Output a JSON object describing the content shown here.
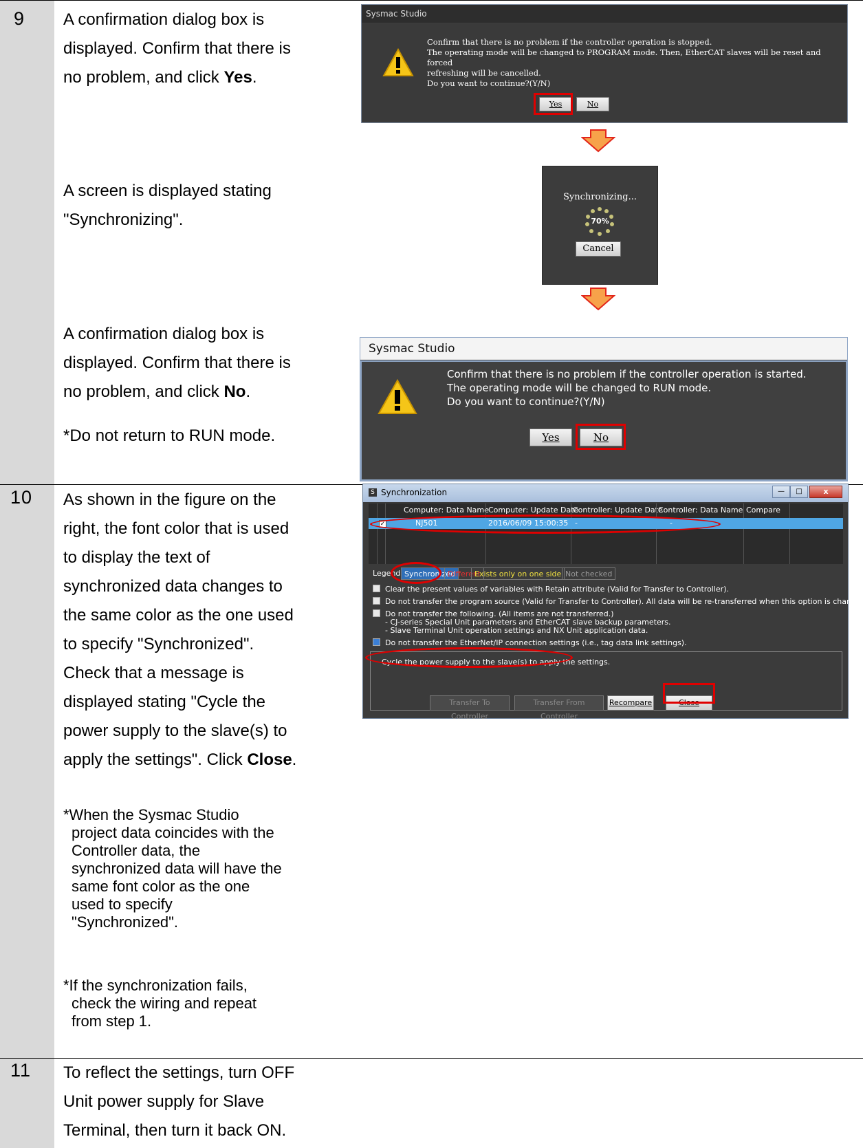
{
  "steps": [
    {
      "number": "9"
    },
    {
      "number": "10"
    },
    {
      "number": "11"
    }
  ],
  "step9": {
    "text1_lines": [
      "A confirmation dialog box is",
      "displayed. Confirm that there is",
      "no problem, and click "
    ],
    "text1_bold": "Yes",
    "text1_end": ".",
    "text2_lines": [
      "A screen is displayed stating",
      "\"Synchronizing\"."
    ],
    "text3_lines": [
      "A confirmation dialog box is",
      "displayed. Confirm that there is",
      "no problem, and click "
    ],
    "text3_bold": "No",
    "text3_end": ".",
    "text3_note": "*Do not return to RUN mode."
  },
  "dialog1": {
    "title": "Sysmac Studio",
    "lines": [
      "Confirm that there is no problem if the controller operation is stopped.",
      "The operating mode will be changed to PROGRAM mode. Then, EtherCAT slaves will be reset and forced",
      "refreshing will be cancelled.",
      "Do you want to continue?(Y/N)"
    ],
    "yes": "Yes",
    "no": "No"
  },
  "progress": {
    "title": "Synchronizing...",
    "percent": "70%",
    "cancel": "Cancel"
  },
  "dialog2": {
    "title": "Sysmac Studio",
    "lines": [
      "Confirm that there is no problem if the controller operation is started.",
      "The operating mode will be changed to RUN mode.",
      "Do you want to continue?(Y/N)"
    ],
    "yes": "Yes",
    "no": "No"
  },
  "step10": {
    "lines": [
      "As shown in the figure on the",
      "right, the font color that is used",
      "to display the text of",
      "synchronized data changes to",
      "the same color as the one used",
      "to specify \"Synchronized\".",
      "Check that a message is",
      "displayed stating \"Cycle the",
      "power supply to the slave(s) to",
      "apply the settings\". Click "
    ],
    "bold": "Close",
    "end": ".",
    "note1": [
      "*When the Sysmac Studio",
      "project data coincides with the",
      "Controller data, the",
      "synchronized data will have the",
      "same font color as the one",
      "used to specify",
      "\"Synchronized\"."
    ],
    "note2": [
      "*If the synchronization fails,",
      "check the wiring and repeat",
      "from step 1."
    ]
  },
  "sync": {
    "title": "Synchronization",
    "columns": [
      "Computer: Data Name",
      "Computer: Update Date",
      "Controller: Update Date",
      "Controller: Data Name",
      "Compare"
    ],
    "row": {
      "name": "NJ501",
      "computer_date": "2016/06/09 15:00:35",
      "controller_date": "-",
      "controller_name": "-"
    },
    "legend_label": "Legend",
    "legend": [
      "Synchronized",
      "Different",
      "Exists only on one side",
      "Not checked"
    ],
    "options": [
      "Clear the present values of variables with Retain attribute (Valid for Transfer to Controller).",
      "Do not transfer the program source (Valid for Transfer to Controller). All data will be re-transferred when this option is changed.",
      "Do not transfer the following. (All items are not transferred.)",
      "- CJ-series Special Unit parameters and EtherCAT slave backup parameters.",
      "- Slave Terminal Unit operation settings and NX Unit application data.",
      "Do not transfer the EtherNet/IP connection settings (i.e., tag data link settings)."
    ],
    "message": "Cycle the power supply to the slave(s) to apply the settings.",
    "buttons": [
      "Transfer To Controller",
      "Transfer From Controller",
      "Recompare",
      "Close"
    ]
  },
  "step11": {
    "lines": [
      "To reflect the settings, turn OFF",
      "Unit power supply for Slave",
      "Terminal, then turn it back ON."
    ]
  }
}
